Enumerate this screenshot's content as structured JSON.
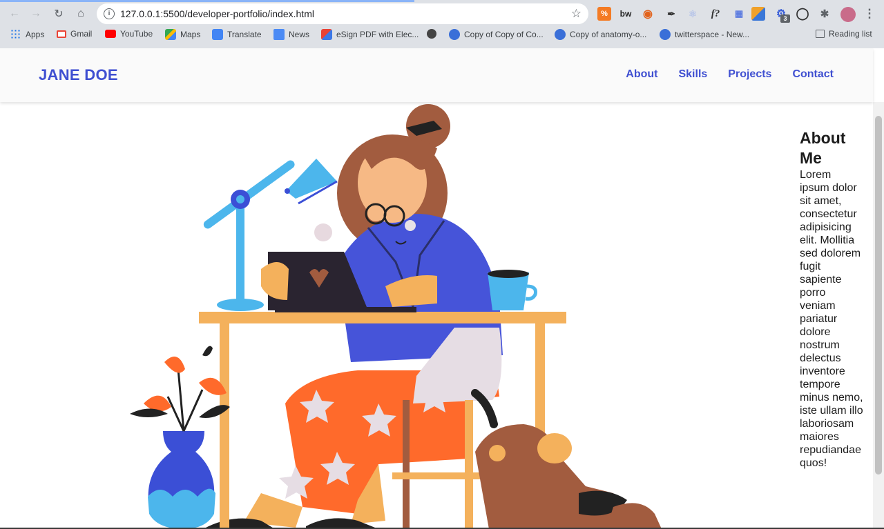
{
  "browser": {
    "url": "127.0.0.1:5500/developer-portfolio/index.html",
    "bookmarks": [
      {
        "label": "Apps",
        "icon": "apps-grid-icon"
      },
      {
        "label": "Gmail",
        "icon": "gmail-icon"
      },
      {
        "label": "YouTube",
        "icon": "youtube-icon"
      },
      {
        "label": "Maps",
        "icon": "maps-icon"
      },
      {
        "label": "Translate",
        "icon": "translate-icon"
      },
      {
        "label": "News",
        "icon": "news-icon"
      },
      {
        "label": "eSign PDF with Elec...",
        "icon": "esign-icon"
      },
      {
        "label": "",
        "icon": "globe-icon"
      },
      {
        "label": "Copy of Copy of Co...",
        "icon": "docs-icon"
      },
      {
        "label": "Copy of anatomy-o...",
        "icon": "docs-icon"
      },
      {
        "label": "twitterspace - New...",
        "icon": "docs-icon"
      }
    ],
    "reading_list": "Reading list",
    "extension_badge": "3"
  },
  "site": {
    "brand": "JANE DOE",
    "nav": [
      "About",
      "Skills",
      "Projects",
      "Contact"
    ],
    "about": {
      "heading": "About Me",
      "body": "Lorem ipsum dolor sit amet, consectetur adipisicing elit. Mollitia sed dolorem fugit sapiente porro veniam pariatur dolore nostrum delectus inventore tempore minus nemo, iste ullam illo laboriosam maiores repudiandae quos!"
    }
  },
  "colors": {
    "brand": "#3f4fd1",
    "orange": "#ff6a2b",
    "blue_shirt": "#4654d9",
    "lamp": "#4cb6ec",
    "desk": "#f4b15c",
    "hair": "#a25c3f"
  }
}
